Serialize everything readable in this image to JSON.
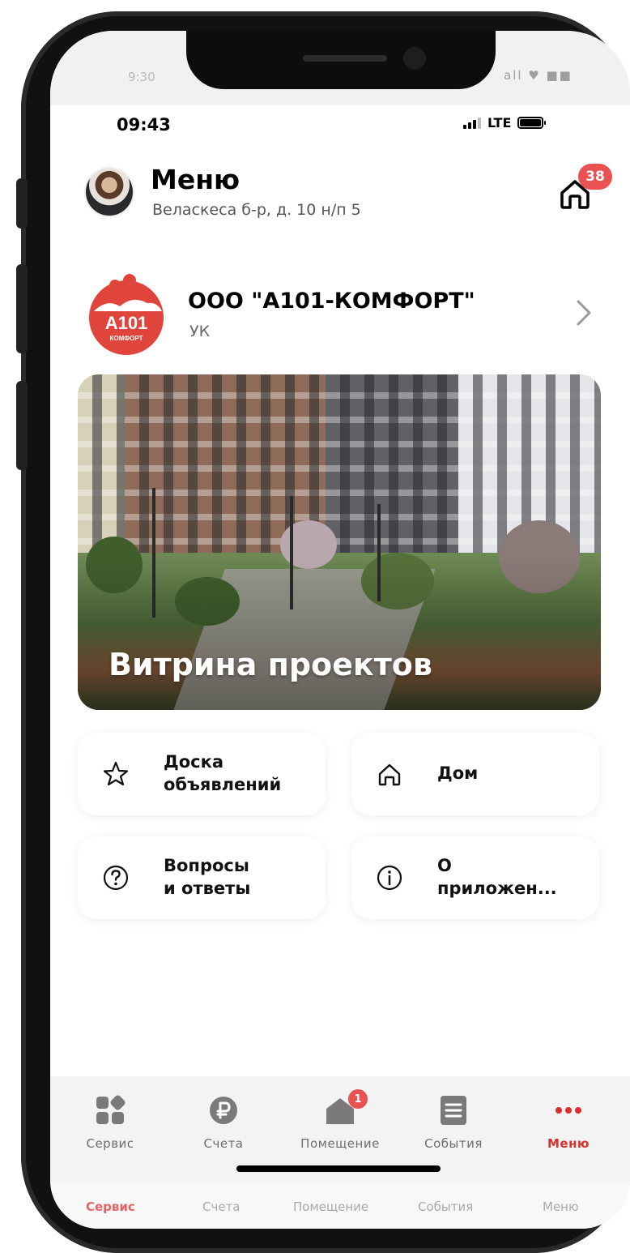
{
  "outer_status": {
    "time": "9:30",
    "icons": "all ♥ ■■"
  },
  "status_bar": {
    "time": "09:43",
    "network": "LTE"
  },
  "header": {
    "title": "Меню",
    "address": "Веласкеса б-р, д. 10 н/п 5",
    "home_badge": "38"
  },
  "company": {
    "logo_text": "А101",
    "logo_subtext": "КОМФОРТ",
    "name": "ООО \"А101-КОМФОРТ\"",
    "type": "УК"
  },
  "banner": {
    "title": "Витрина проектов"
  },
  "tiles": [
    {
      "line1": "Доска",
      "line2": "объявлений",
      "icon": "star-icon"
    },
    {
      "line1": "Дом",
      "line2": "",
      "icon": "home-icon"
    },
    {
      "line1": "Вопросы",
      "line2": "и ответы",
      "icon": "question-icon"
    },
    {
      "line1": "О",
      "line2": "приложен...",
      "icon": "info-icon"
    }
  ],
  "tabbar": {
    "items": [
      {
        "label": "Сервис",
        "icon": "grid-icon"
      },
      {
        "label": "Счета",
        "icon": "ruble-icon"
      },
      {
        "label": "Помещение",
        "icon": "house-icon",
        "badge": "1"
      },
      {
        "label": "События",
        "icon": "list-icon"
      },
      {
        "label": "Меню",
        "icon": "dots-icon"
      }
    ],
    "active_index": 4
  },
  "ghost_tabbar": {
    "items": [
      "Сервис",
      "Счета",
      "Помещение",
      "События",
      "Меню"
    ],
    "active_index": 0
  },
  "colors": {
    "accent": "#d5302c",
    "badge": "#ea5153",
    "logo_red": "#e0453b"
  }
}
